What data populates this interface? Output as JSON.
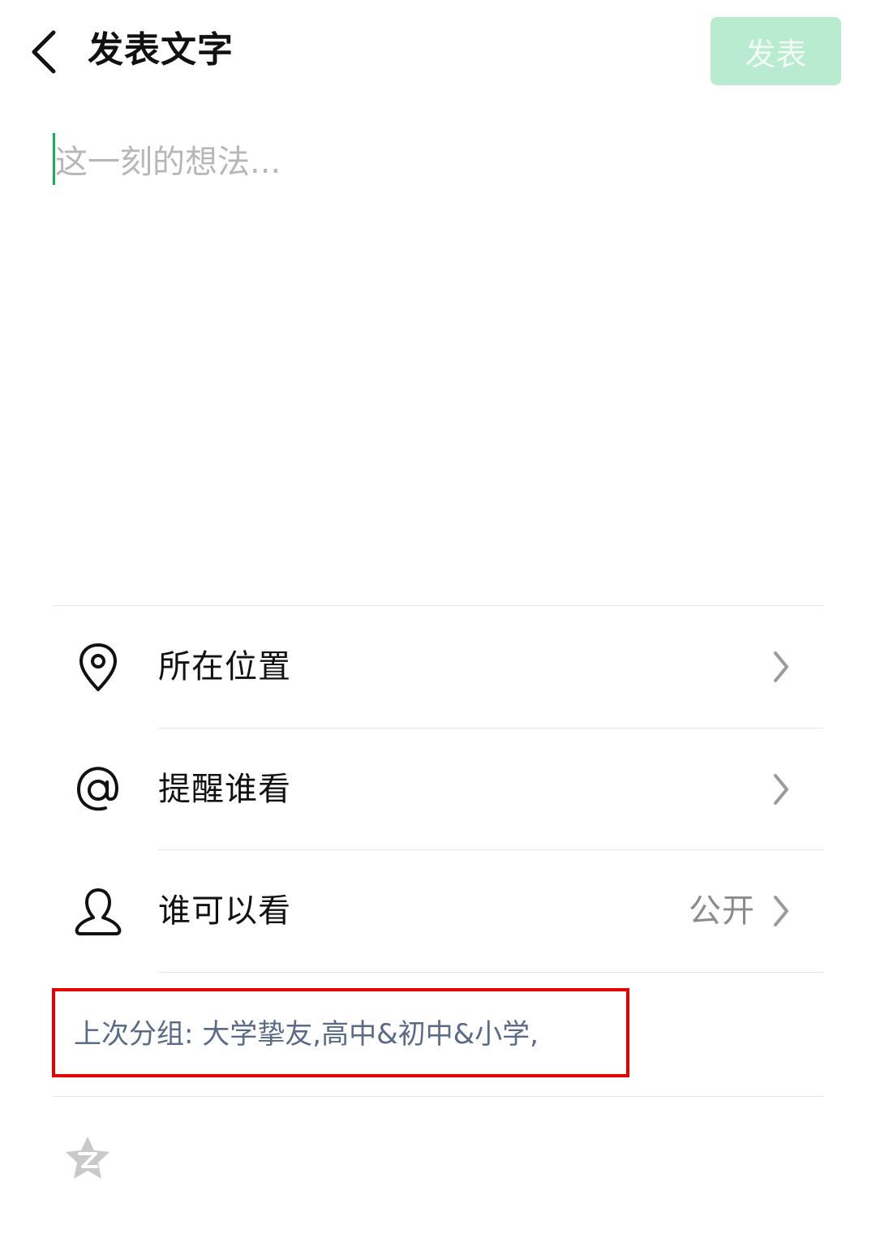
{
  "header": {
    "title": "发表文字",
    "publish_label": "发表",
    "back_icon": "chevron-left-icon",
    "publish_button_color": "#b8ebcf"
  },
  "composer": {
    "placeholder": "这一刻的想法...",
    "value": "",
    "cursor_color": "#16b05d"
  },
  "menu": {
    "items": [
      {
        "icon": "location-pin-icon",
        "label": "所在位置",
        "value": "",
        "chevron": "chevron-right-icon"
      },
      {
        "icon": "at-sign-icon",
        "label": "提醒谁看",
        "value": "",
        "chevron": "chevron-right-icon"
      },
      {
        "icon": "person-outline-icon",
        "label": "谁可以看",
        "value": "公开",
        "chevron": "chevron-right-icon"
      }
    ]
  },
  "last_group": {
    "label": "上次分组: 大学挚友,高中&初中&小学,",
    "highlight_color": "#e50000",
    "text_color": "#596b89"
  },
  "footer": {
    "icon": "qzone-star-icon"
  }
}
